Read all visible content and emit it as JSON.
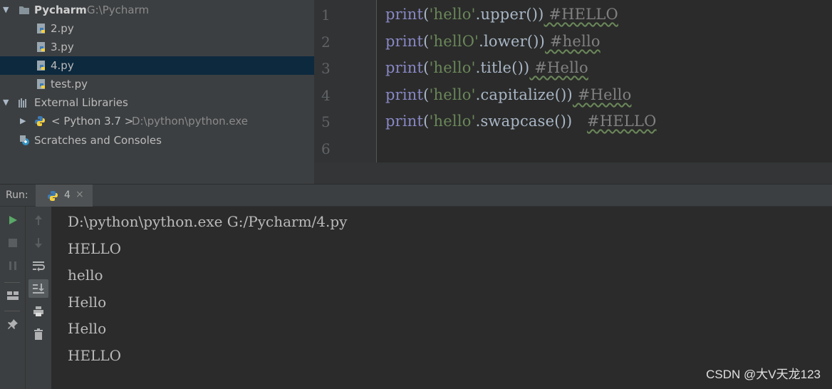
{
  "project_tree": {
    "root": {
      "name": "Pycharm",
      "path": "G:\\Pycharm"
    },
    "files": [
      {
        "name": "2.py",
        "selected": false
      },
      {
        "name": "3.py",
        "selected": false
      },
      {
        "name": "4.py",
        "selected": true
      },
      {
        "name": "test.py",
        "selected": false
      }
    ],
    "external_libraries": {
      "label": "External Libraries"
    },
    "python_sdk": {
      "label": "< Python 3.7 >",
      "path": "D:\\python\\python.exe"
    },
    "scratches": {
      "label": "Scratches and Consoles"
    }
  },
  "editor": {
    "line_numbers": [
      "1",
      "2",
      "3",
      "4",
      "5",
      "6"
    ],
    "lines": [
      {
        "kw": "print",
        "open": "(",
        "str": "'hello'",
        "rest": ".upper())",
        "comment": " #HELLO"
      },
      {
        "kw": "print",
        "open": "(",
        "str": "'hellO'",
        "rest": ".lower())",
        "comment": " #hello"
      },
      {
        "kw": "print",
        "open": "(",
        "str": "'hello'",
        "rest": ".title())",
        "comment": " #Hello"
      },
      {
        "kw": "print",
        "open": "(",
        "str": "'hello'",
        "rest": ".capitalize())",
        "comment": " #Hello"
      },
      {
        "kw": "print",
        "open": "(",
        "str": "'hello'",
        "rest": ".swapcase())   ",
        "comment": "#HELLO"
      }
    ]
  },
  "run_window": {
    "label": "Run:",
    "tab": {
      "name": "4",
      "close": "×"
    }
  },
  "console": {
    "lines": [
      "D:\\python\\python.exe G:/Pycharm/4.py",
      "HELLO",
      "hello",
      "Hello",
      "Hello",
      "HELLO"
    ]
  },
  "watermark": "CSDN @大V天龙123",
  "colors": {
    "keyword": "#8888c6",
    "string": "#6a8759",
    "comment": "#808080",
    "selection": "#0d293e",
    "run_green": "#59a869"
  }
}
